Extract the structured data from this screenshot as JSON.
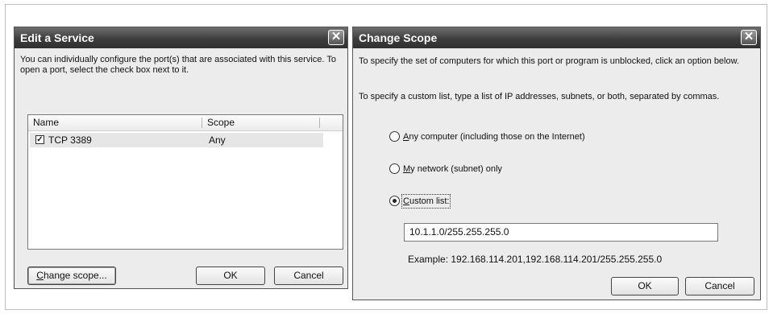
{
  "edit_service": {
    "title": "Edit a Service",
    "description": "You can individually configure the port(s) that are associated with this service. To open a port, select the check box next to it.",
    "columns": [
      "Name",
      "Scope"
    ],
    "rows": [
      {
        "name": "TCP 3389",
        "scope": "Any",
        "checked": true
      }
    ],
    "change_scope_button": {
      "mnemonic": "C",
      "rest": "hange scope..."
    },
    "ok_button": "OK",
    "cancel_button": "Cancel"
  },
  "change_scope": {
    "title": "Change Scope",
    "intro": "To specify the set of computers for which this port or program is unblocked, click an option below.",
    "custom_hint": "To specify a custom list, type a list of IP addresses, subnets, or both, separated by commas.",
    "options": [
      {
        "mnemonic": "A",
        "rest": "ny computer (including those on the Internet)",
        "selected": false
      },
      {
        "mnemonic": "M",
        "rest": "y network (subnet) only",
        "selected": false
      },
      {
        "mnemonic": "C",
        "rest": "ustom list:",
        "selected": true
      }
    ],
    "custom_list_value": "10.1.1.0/255.255.255.0",
    "example": "Example: 192.168.114.201,192.168.114.201/255.255.255.0",
    "ok_button": "OK",
    "cancel_button": "Cancel"
  },
  "close_glyph": "✕",
  "check_glyph": "✓"
}
